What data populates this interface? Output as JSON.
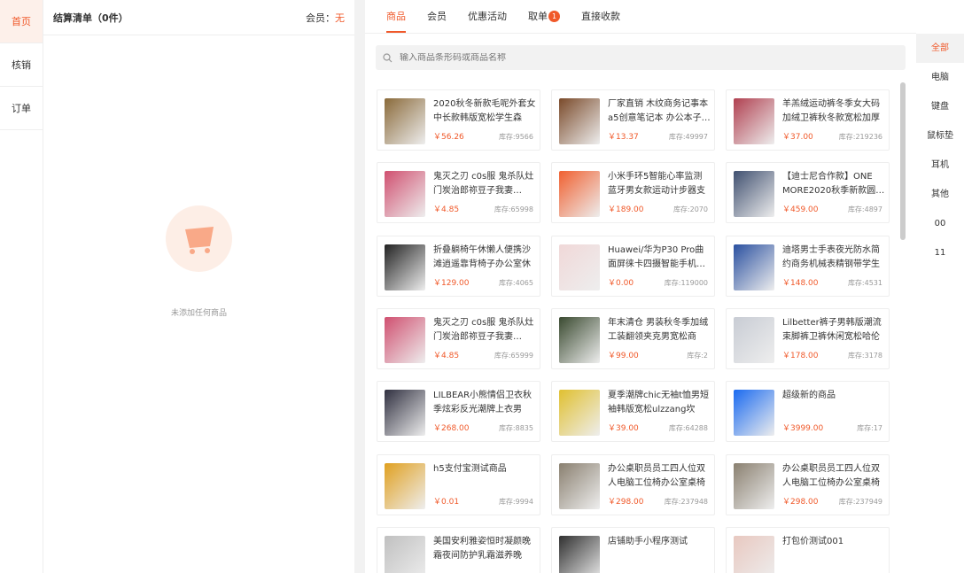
{
  "nav": [
    {
      "label": "首页"
    },
    {
      "label": "核销"
    },
    {
      "label": "订单"
    }
  ],
  "cart": {
    "title": "结算清单（0件）",
    "member_label": "会员：",
    "member_value": "无",
    "empty_text": "未添加任何商品"
  },
  "tabs": [
    {
      "label": "商品"
    },
    {
      "label": "会员"
    },
    {
      "label": "优惠活动"
    },
    {
      "label": "取单",
      "badge": "1"
    },
    {
      "label": "直接收款"
    }
  ],
  "search": {
    "placeholder": "输入商品条形码或商品名称"
  },
  "products": [
    {
      "name": "2020秋冬新款毛呢外套女中长款韩版宽松学生森系…",
      "price": "￥56.26",
      "stock": "库存:9566",
      "color": "#8a6a3a"
    },
    {
      "name": "厂家直销 木纹商务记事本a5创意笔记本 办公本子…",
      "price": "￥13.37",
      "stock": "库存:49997",
      "color": "#7a4a2a"
    },
    {
      "name": "羊羔绒运动裤冬季女大码加绒卫裤秋冬款宽松加厚显…",
      "price": "￥37.00",
      "stock": "库存:219236",
      "color": "#b04050"
    },
    {
      "name": "鬼灭之刃 c0s服 鬼杀队灶门炭治郎祢豆子我妻…",
      "price": "￥4.85",
      "stock": "库存:65998",
      "color": "#d05070"
    },
    {
      "name": "小米手环5智能心率监测蓝牙男女款运动计步器支付…",
      "price": "￥189.00",
      "stock": "库存:2070",
      "color": "#f06030"
    },
    {
      "name": "【迪士尼合作款】ONE MORE2020秋季新款圆…",
      "price": "￥459.00",
      "stock": "库存:4897",
      "color": "#405070"
    },
    {
      "name": "折叠躺椅午休懒人便携沙滩逍遥靠背椅子办公室休闲…",
      "price": "￥129.00",
      "stock": "库存:4065",
      "color": "#222222"
    },
    {
      "name": "Huawei/华为P30 Pro曲面屏徕卡四摄智能手机…",
      "price": "￥0.00",
      "stock": "库存:119000",
      "color": "#f0d8d8"
    },
    {
      "name": "迪塔男士手表夜光防水简约商务机械表精钢带学生手…",
      "price": "￥148.00",
      "stock": "库存:4531",
      "color": "#2a50a0"
    },
    {
      "name": "鬼灭之刃 c0s服 鬼杀队灶门炭治郎祢豆子我妻…",
      "price": "￥4.85",
      "stock": "库存:65999",
      "color": "#d05070"
    },
    {
      "name": "年末清仓 男装秋冬季加绒工装翻领夹克男宽松商务…",
      "price": "￥99.00",
      "stock": "库存:2",
      "color": "#3a4a30"
    },
    {
      "name": "Lilbetter裤子男韩版潮流束脚裤卫裤休闲宽松哈伦长…",
      "price": "￥178.00",
      "stock": "库存:3178",
      "color": "#c8ccd4"
    },
    {
      "name": "LILBEAR小熊情侣卫衣秋季炫彩反光潮牌上衣男潮…",
      "price": "￥268.00",
      "stock": "库存:8835",
      "color": "#303040"
    },
    {
      "name": "夏季潮牌chic无袖t恤男短袖韩版宽松ulzzang坎肩…",
      "price": "￥39.00",
      "stock": "库存:64288",
      "color": "#e0c030"
    },
    {
      "name": "超级新的商品",
      "price": "￥3999.00",
      "stock": "库存:17",
      "color": "#1a6af0"
    },
    {
      "name": "h5支付宝测试商品",
      "price": "￥0.01",
      "stock": "库存:9994",
      "color": "#e0a020"
    },
    {
      "name": "办公桌职员员工四人位双人电脑工位椅办公室桌椅组…",
      "price": "￥298.00",
      "stock": "库存:237948",
      "color": "#8a8070"
    },
    {
      "name": "办公桌职员员工四人位双人电脑工位椅办公室桌椅组…",
      "price": "￥298.00",
      "stock": "库存:237949",
      "color": "#8a8070"
    },
    {
      "name": "美国安利雅姿恒时凝颜晚霜夜间防护乳霜滋养晚霜…",
      "price": "",
      "stock": "",
      "color": "#c0c0c0"
    },
    {
      "name": "店铺助手小程序测试",
      "price": "",
      "stock": "",
      "color": "#303030"
    },
    {
      "name": "打包价测试001",
      "price": "",
      "stock": "",
      "color": "#e8c8c0"
    }
  ],
  "categories": [
    {
      "label": "全部"
    },
    {
      "label": "电脑"
    },
    {
      "label": "键盘"
    },
    {
      "label": "鼠标垫"
    },
    {
      "label": "耳机"
    },
    {
      "label": "其他"
    },
    {
      "label": "00"
    },
    {
      "label": "11"
    }
  ]
}
